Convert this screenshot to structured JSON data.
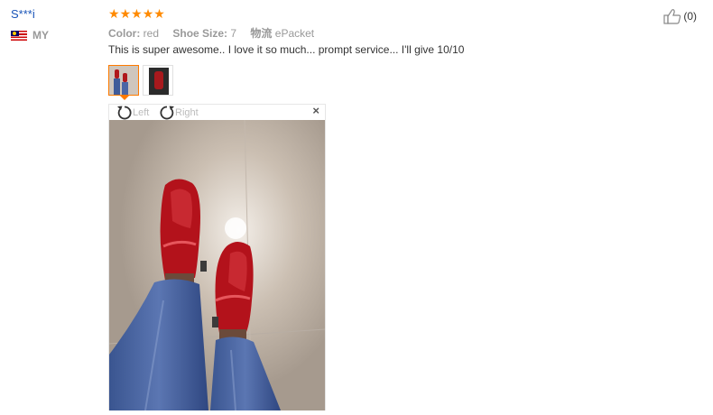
{
  "reviewer": {
    "name": "S***i",
    "country_code": "MY"
  },
  "rating": {
    "stars": 5,
    "max": 5,
    "color": "#ff8a00"
  },
  "attributes": [
    {
      "key": "Color:",
      "value": "red"
    },
    {
      "key": "Shoe Size:",
      "value": "7"
    },
    {
      "key": "物流",
      "value": "ePacket"
    }
  ],
  "review_text": "This is super awesome.. I love it so much... prompt service... I'll give 10/10",
  "helpful": {
    "count": "(0)",
    "icon": "thumbs-up-icon"
  },
  "viewer": {
    "rotate_left_label": "Left",
    "rotate_right_label": "Right",
    "close_label": "×"
  },
  "colors": {
    "accent": "#ff7a00",
    "link": "#1a55b8",
    "muted": "#999999"
  }
}
